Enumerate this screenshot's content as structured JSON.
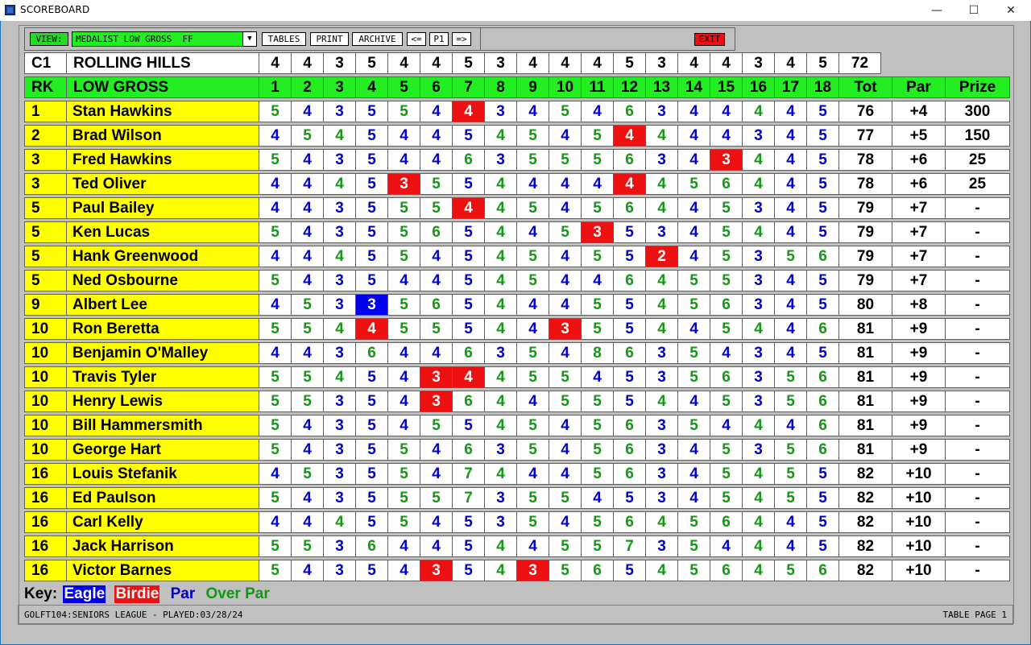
{
  "window": {
    "title": "SCOREBOARD",
    "minimize": "—",
    "maximize": "☐",
    "close": "✕"
  },
  "toolbar": {
    "view_label": "VIEW:",
    "view_value": "MEDALIST LOW GROSS  FF",
    "dropdown_arrow": "▼",
    "tables": "TABLES",
    "print": "PRINT",
    "archive": "ARCHIVE",
    "prev": "<=",
    "page": "P1",
    "next": "=>",
    "exit": "EXIT"
  },
  "course": {
    "code": "C1",
    "name": "ROLLING HILLS",
    "pars": [
      4,
      4,
      3,
      5,
      4,
      4,
      5,
      3,
      4,
      4,
      4,
      5,
      3,
      4,
      4,
      3,
      4,
      5
    ],
    "total": "72"
  },
  "header": {
    "rank": "RK",
    "title": "LOW GROSS",
    "holes": [
      "1",
      "2",
      "3",
      "4",
      "5",
      "6",
      "7",
      "8",
      "9",
      "10",
      "11",
      "12",
      "13",
      "14",
      "15",
      "16",
      "17",
      "18"
    ],
    "total": "Tot",
    "par": "Par",
    "prize": "Prize"
  },
  "players": [
    {
      "rank": "1",
      "name": "Stan Hawkins",
      "scores": [
        5,
        4,
        3,
        5,
        5,
        4,
        4,
        3,
        4,
        5,
        4,
        6,
        3,
        4,
        4,
        4,
        4,
        5
      ],
      "total": "76",
      "par": "+4",
      "prize": "300"
    },
    {
      "rank": "2",
      "name": "Brad Wilson",
      "scores": [
        4,
        5,
        4,
        5,
        4,
        4,
        5,
        4,
        5,
        4,
        5,
        4,
        4,
        4,
        4,
        3,
        4,
        5
      ],
      "total": "77",
      "par": "+5",
      "prize": "150"
    },
    {
      "rank": "3",
      "name": "Fred Hawkins",
      "scores": [
        5,
        4,
        3,
        5,
        4,
        4,
        6,
        3,
        5,
        5,
        5,
        6,
        3,
        4,
        3,
        4,
        4,
        5
      ],
      "total": "78",
      "par": "+6",
      "prize": "25"
    },
    {
      "rank": "3",
      "name": "Ted Oliver",
      "scores": [
        4,
        4,
        4,
        5,
        3,
        5,
        5,
        4,
        4,
        4,
        4,
        4,
        4,
        5,
        6,
        4,
        4,
        5
      ],
      "total": "78",
      "par": "+6",
      "prize": "25"
    },
    {
      "rank": "5",
      "name": "Paul Bailey",
      "scores": [
        4,
        4,
        3,
        5,
        5,
        5,
        4,
        4,
        5,
        4,
        5,
        6,
        4,
        4,
        5,
        3,
        4,
        5
      ],
      "total": "79",
      "par": "+7",
      "prize": "-"
    },
    {
      "rank": "5",
      "name": "Ken Lucas",
      "scores": [
        5,
        4,
        3,
        5,
        5,
        6,
        5,
        4,
        4,
        5,
        3,
        5,
        3,
        4,
        5,
        4,
        4,
        5
      ],
      "total": "79",
      "par": "+7",
      "prize": "-"
    },
    {
      "rank": "5",
      "name": "Hank Greenwood",
      "scores": [
        4,
        4,
        4,
        5,
        5,
        4,
        5,
        4,
        5,
        4,
        5,
        5,
        2,
        4,
        5,
        3,
        5,
        6
      ],
      "total": "79",
      "par": "+7",
      "prize": "-"
    },
    {
      "rank": "5",
      "name": "Ned Osbourne",
      "scores": [
        5,
        4,
        3,
        5,
        4,
        4,
        5,
        4,
        5,
        4,
        4,
        6,
        4,
        5,
        5,
        3,
        4,
        5
      ],
      "total": "79",
      "par": "+7",
      "prize": "-"
    },
    {
      "rank": "9",
      "name": "Albert Lee",
      "scores": [
        4,
        5,
        3,
        3,
        5,
        6,
        5,
        4,
        4,
        4,
        5,
        5,
        4,
        5,
        6,
        3,
        4,
        5
      ],
      "total": "80",
      "par": "+8",
      "prize": "-"
    },
    {
      "rank": "10",
      "name": "Ron Beretta",
      "scores": [
        5,
        5,
        4,
        4,
        5,
        5,
        5,
        4,
        4,
        3,
        5,
        5,
        4,
        4,
        5,
        4,
        4,
        6
      ],
      "total": "81",
      "par": "+9",
      "prize": "-"
    },
    {
      "rank": "10",
      "name": "Benjamin O'Malley",
      "scores": [
        4,
        4,
        3,
        6,
        4,
        4,
        6,
        3,
        5,
        4,
        8,
        6,
        3,
        5,
        4,
        3,
        4,
        5
      ],
      "total": "81",
      "par": "+9",
      "prize": "-"
    },
    {
      "rank": "10",
      "name": "Travis Tyler",
      "scores": [
        5,
        5,
        4,
        5,
        4,
        3,
        4,
        4,
        5,
        5,
        4,
        5,
        3,
        5,
        6,
        3,
        5,
        6
      ],
      "total": "81",
      "par": "+9",
      "prize": "-"
    },
    {
      "rank": "10",
      "name": "Henry Lewis",
      "scores": [
        5,
        5,
        3,
        5,
        4,
        3,
        6,
        4,
        4,
        5,
        5,
        5,
        4,
        4,
        5,
        3,
        5,
        6
      ],
      "total": "81",
      "par": "+9",
      "prize": "-"
    },
    {
      "rank": "10",
      "name": "Bill Hammersmith",
      "scores": [
        5,
        4,
        3,
        5,
        4,
        5,
        5,
        4,
        5,
        4,
        5,
        6,
        3,
        5,
        4,
        4,
        4,
        6
      ],
      "total": "81",
      "par": "+9",
      "prize": "-"
    },
    {
      "rank": "10",
      "name": "George Hart",
      "scores": [
        5,
        4,
        3,
        5,
        5,
        4,
        6,
        3,
        5,
        4,
        5,
        6,
        3,
        4,
        5,
        3,
        5,
        6
      ],
      "total": "81",
      "par": "+9",
      "prize": "-"
    },
    {
      "rank": "16",
      "name": "Louis Stefanik",
      "scores": [
        4,
        5,
        3,
        5,
        5,
        4,
        7,
        4,
        4,
        4,
        5,
        6,
        3,
        4,
        5,
        4,
        5,
        5
      ],
      "total": "82",
      "par": "+10",
      "prize": "-"
    },
    {
      "rank": "16",
      "name": "Ed Paulson",
      "scores": [
        5,
        4,
        3,
        5,
        5,
        5,
        7,
        3,
        5,
        5,
        4,
        5,
        3,
        4,
        5,
        4,
        5,
        5
      ],
      "total": "82",
      "par": "+10",
      "prize": "-"
    },
    {
      "rank": "16",
      "name": "Carl Kelly",
      "scores": [
        4,
        4,
        4,
        5,
        5,
        4,
        5,
        3,
        5,
        4,
        5,
        6,
        4,
        5,
        6,
        4,
        4,
        5
      ],
      "total": "82",
      "par": "+10",
      "prize": "-"
    },
    {
      "rank": "16",
      "name": "Jack Harrison",
      "scores": [
        5,
        5,
        3,
        6,
        4,
        4,
        5,
        4,
        4,
        5,
        5,
        7,
        3,
        5,
        4,
        4,
        4,
        5
      ],
      "total": "82",
      "par": "+10",
      "prize": "-"
    },
    {
      "rank": "16",
      "name": "Victor Barnes",
      "scores": [
        5,
        4,
        3,
        5,
        4,
        3,
        5,
        4,
        3,
        5,
        6,
        5,
        4,
        5,
        6,
        4,
        5,
        6
      ],
      "total": "82",
      "par": "+10",
      "prize": "-"
    }
  ],
  "key": {
    "label": "Key:",
    "eagle": "Eagle",
    "birdie": "Birdie",
    "par": "Par",
    "over_par": "Over Par"
  },
  "colors": {
    "eagle_bg": "#0000ee",
    "birdie_bg": "#ee1111",
    "par_text": "#0000cc",
    "over_par_text": "#119911",
    "name_bg": "#ffff00",
    "header_bg": "#22ee22",
    "panel_bg": "#c0c0c0"
  },
  "status": {
    "left": "GOLFT104:SENIORS LEAGUE - PLAYED:03/28/24",
    "right": "TABLE PAGE 1"
  }
}
